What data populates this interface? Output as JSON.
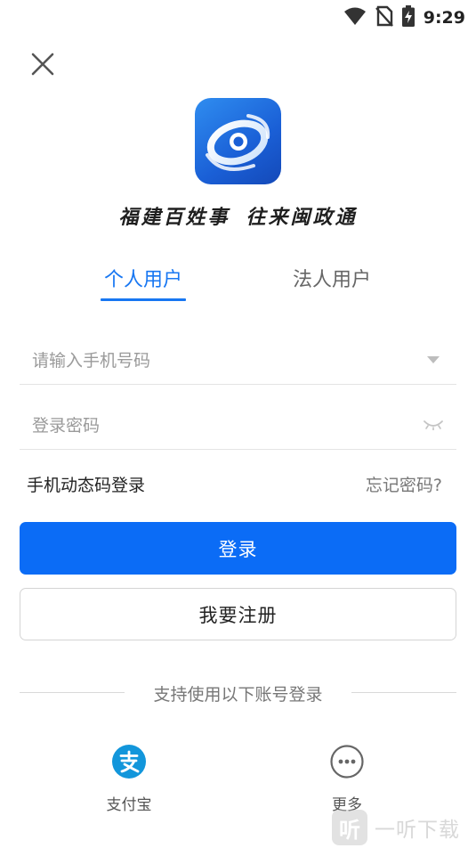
{
  "status_bar": {
    "time": "9:29",
    "icons": [
      "wifi-icon",
      "no-sim-icon",
      "battery-charging-icon"
    ]
  },
  "header": {
    "close_icon": "close-icon"
  },
  "branding": {
    "logo_icon": "app-logo-icon",
    "slogan_part1": "福建百姓事",
    "slogan_part2": "往来闽政通"
  },
  "tabs": [
    {
      "label": "个人用户",
      "active": true
    },
    {
      "label": "法人用户",
      "active": false
    }
  ],
  "form": {
    "phone_placeholder": "请输入手机号码",
    "phone_value": "",
    "password_placeholder": "登录密码",
    "password_value": "",
    "dropdown_icon": "dropdown-arrow-icon",
    "visibility_icon": "eye-closed-icon"
  },
  "links": {
    "sms_login": "手机动态码登录",
    "forgot_password": "忘记密码?"
  },
  "buttons": {
    "login": "登录",
    "register": "我要注册"
  },
  "alt_login": {
    "divider_text": "支持使用以下账号登录",
    "options": [
      {
        "label": "支付宝",
        "icon": "alipay-icon"
      },
      {
        "label": "更多",
        "icon": "more-icon"
      }
    ]
  },
  "watermark": {
    "box": "听",
    "text": "一听下载"
  },
  "colors": {
    "primary": "#0b6cf6",
    "tab_active": "#1877f2",
    "alipay": "#1296db"
  }
}
